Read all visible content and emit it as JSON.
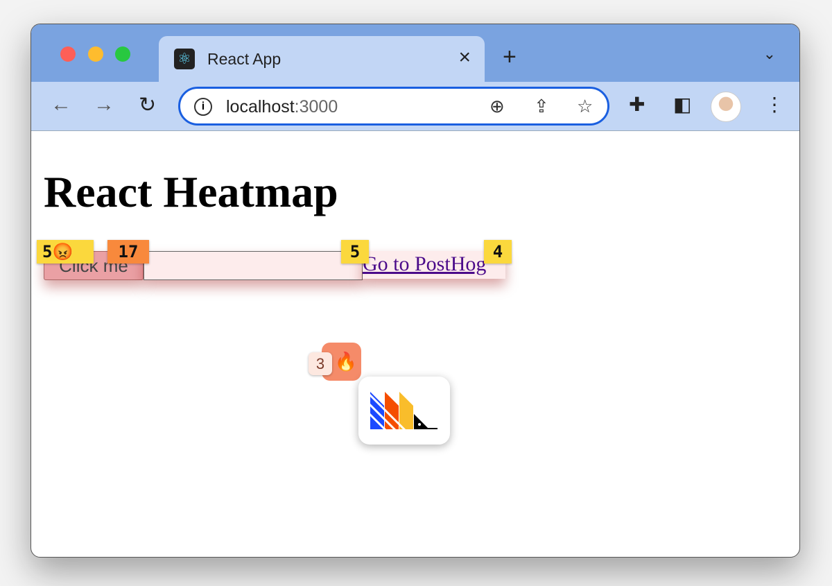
{
  "browser": {
    "tab_title": "React App",
    "url_host": "localhost",
    "url_port": ":3000"
  },
  "page": {
    "heading": "React Heatmap",
    "button_label": "Click me",
    "input_value": "",
    "link_label": "Go to PostHog"
  },
  "heatmap": {
    "badges": [
      {
        "target": "button",
        "count": "5",
        "emoji": "😡",
        "color": "#fbd83d"
      },
      {
        "target": "button",
        "count": "17",
        "color": "#f8893c"
      },
      {
        "target": "input",
        "count": "5",
        "color": "#fbd83d"
      },
      {
        "target": "link",
        "count": "4",
        "color": "#fbd83d"
      }
    ],
    "toolbar": {
      "count": "3",
      "icon": "fire-icon",
      "emoji": "🔥",
      "color": "#f58b69"
    }
  },
  "colors": {
    "tab_bar": "#7aa3e0",
    "toolbar": "#c2d6f5",
    "omnibox_border": "#1a5fe0"
  }
}
